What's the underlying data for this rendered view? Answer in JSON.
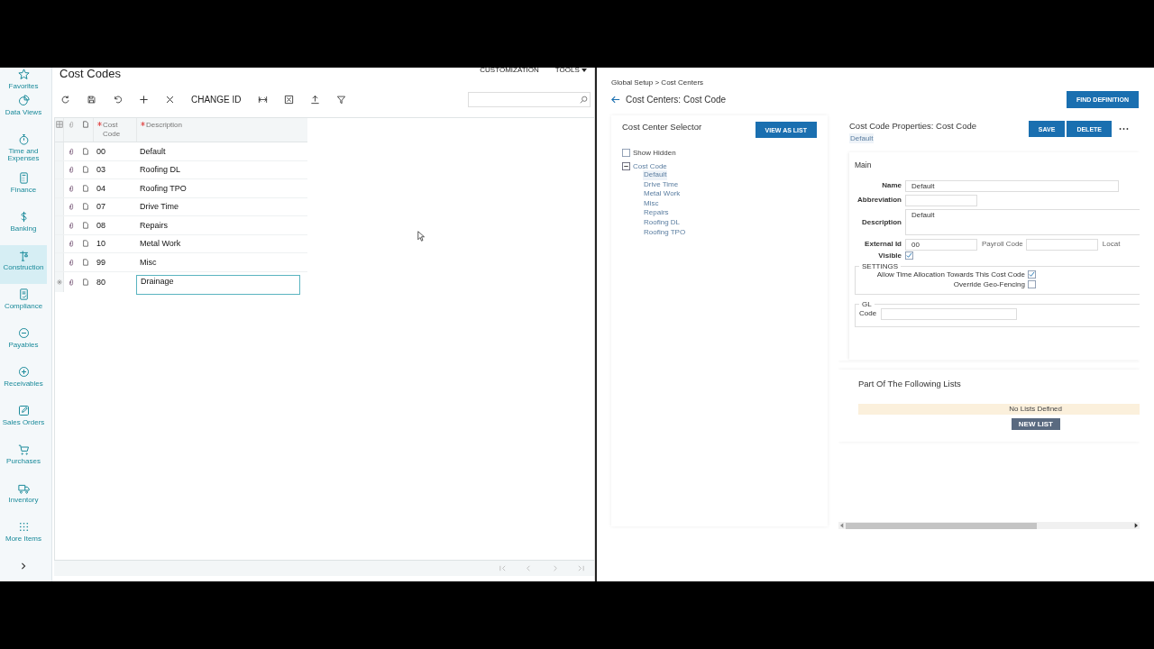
{
  "sidebar": {
    "items": [
      {
        "label": "Favorites",
        "selected": false
      },
      {
        "label": "Data Views",
        "selected": false
      },
      {
        "label": "Time and Expenses",
        "selected": false
      },
      {
        "label": "Finance",
        "selected": false
      },
      {
        "label": "Banking",
        "selected": false
      },
      {
        "label": "Construction",
        "selected": true
      },
      {
        "label": "Compliance",
        "selected": false
      },
      {
        "label": "Payables",
        "selected": false
      },
      {
        "label": "Receivables",
        "selected": false
      },
      {
        "label": "Sales Orders",
        "selected": false
      },
      {
        "label": "Purchases",
        "selected": false
      },
      {
        "label": "Inventory",
        "selected": false
      },
      {
        "label": "More Items",
        "selected": false
      }
    ]
  },
  "cost_codes": {
    "title": "Cost Codes",
    "menu": [
      "CUSTOMIZATION",
      "TOOLS"
    ],
    "change_id": "CHANGE ID",
    "table": {
      "columns": [
        {
          "label": "Cost Code",
          "required": true
        },
        {
          "label": "Description",
          "required": true
        }
      ],
      "rows": [
        {
          "code": "00",
          "description": "Default",
          "new": false
        },
        {
          "code": "03",
          "description": "Roofing DL",
          "new": false
        },
        {
          "code": "04",
          "description": "Roofing TPO",
          "new": false
        },
        {
          "code": "07",
          "description": "Drive Time",
          "new": false
        },
        {
          "code": "08",
          "description": "Repairs",
          "new": false
        },
        {
          "code": "10",
          "description": "Metal Work",
          "new": false
        },
        {
          "code": "99",
          "description": "Misc",
          "new": false
        },
        {
          "code": "80",
          "description": "Drainage",
          "new": true
        }
      ]
    }
  },
  "cost_centers": {
    "breadcrumb": "Global Setup > Cost Centers",
    "title": "Cost Centers: Cost Code",
    "find_button": "FIND DEFINITION",
    "selector": {
      "title": "Cost Center Selector",
      "view_button": "VIEW AS LIST",
      "show_hidden": {
        "label": "Show Hidden",
        "checked": false
      },
      "tree": {
        "label": "Cost Code",
        "expanded": true,
        "children": [
          {
            "label": "Default",
            "selected": true
          },
          {
            "label": "Drive Time",
            "selected": false
          },
          {
            "label": "Metal Work",
            "selected": false
          },
          {
            "label": "Misc",
            "selected": false
          },
          {
            "label": "Repairs",
            "selected": false
          },
          {
            "label": "Roofing DL",
            "selected": false
          },
          {
            "label": "Roofing TPO",
            "selected": false
          }
        ]
      }
    },
    "properties": {
      "title": "Cost Code Properties: Cost Code",
      "subtitle": "Default",
      "buttons": [
        "SAVE",
        "DELETE"
      ],
      "main": {
        "title": "Main",
        "name_label": "Name",
        "name": "Default",
        "abbreviation_label": "Abbreviation",
        "description_label": "Description",
        "description": "Default",
        "external_id_label": "External Id",
        "external_id": "00",
        "payroll_label": "Payroll Code",
        "location_label": "Locat",
        "visible_label": "Visible",
        "visible": true
      },
      "settings": {
        "title": "SETTINGS",
        "options": [
          {
            "label": "Allow Time Allocation Towards This Cost Code",
            "checked": true
          },
          {
            "label": "Override Geo-Fencing",
            "checked": false
          }
        ]
      },
      "gl": {
        "title": "GL",
        "code_label": "Code"
      }
    },
    "lists": {
      "title": "Part Of The Following Lists",
      "empty": "No Lists Defined",
      "button": "NEW LIST"
    }
  }
}
